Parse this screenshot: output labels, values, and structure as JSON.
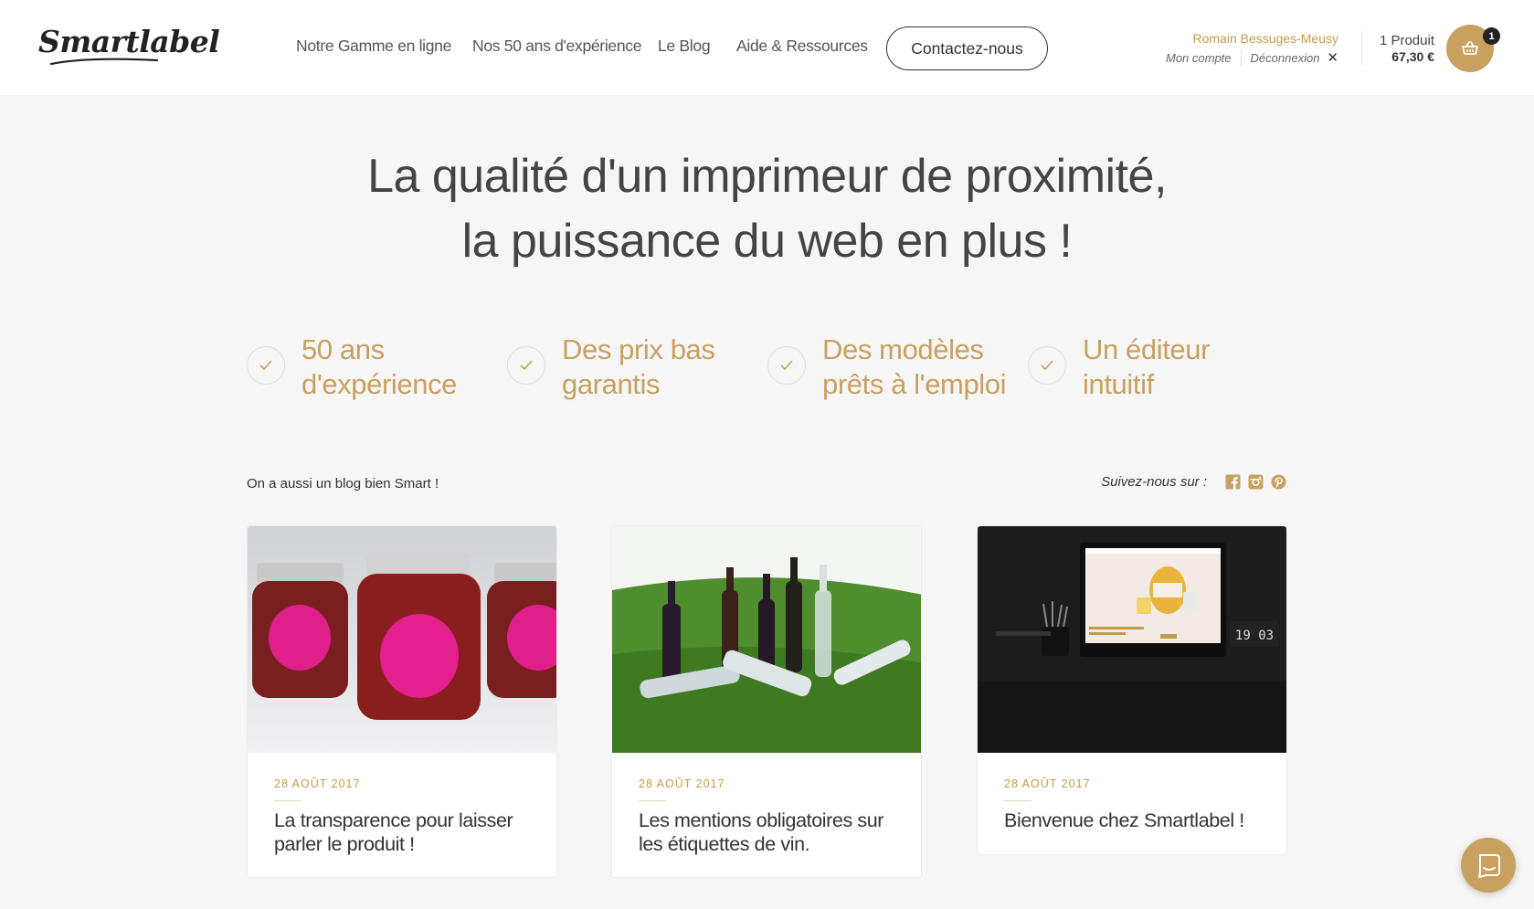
{
  "header": {
    "logo_text": "Smartlabel",
    "nav": [
      {
        "label": "Notre Gamme en ligne"
      },
      {
        "label": "Nos 50 ans d'expérience"
      },
      {
        "label": "Le Blog"
      },
      {
        "label": "Aide & Ressources"
      }
    ],
    "contact_label": "Contactez-nous",
    "user": {
      "name": "Romain Bessuges-Meusy",
      "account_label": "Mon compte",
      "logout_label": "Déconnexion"
    },
    "cart": {
      "count_label": "1 Produit",
      "total": "67,30 €",
      "badge": "1"
    }
  },
  "hero": {
    "line1": "La qualité d'un imprimeur de proximité,",
    "line2": "la puissance du web en plus !"
  },
  "features": [
    {
      "line1": "50 ans",
      "line2": "d'expérience"
    },
    {
      "line1": "Des prix bas",
      "line2": "garantis"
    },
    {
      "line1": "Des modèles",
      "line2": "prêts à l'emploi"
    },
    {
      "line1": "Un éditeur",
      "line2": "intuitif"
    }
  ],
  "blog": {
    "intro": "On a aussi un blog bien Smart !",
    "follow_label": "Suivez-nous sur :",
    "social_icons": [
      "facebook-icon",
      "instagram-icon",
      "pinterest-icon"
    ],
    "posts": [
      {
        "date": "28 AOÛT 2017",
        "title": "La transparence pour laisser parler le produit !",
        "image": "jam-jars"
      },
      {
        "date": "28 AOÛT 2017",
        "title": "Les mentions obligatoires sur les étiquettes de vin.",
        "image": "wine-bottles-on-grass"
      },
      {
        "date": "28 AOÛT 2017",
        "title": "Bienvenue chez Smartlabel !",
        "image": "desk-monitor"
      }
    ]
  },
  "colors": {
    "accent": "#c8a060",
    "background": "#f6f6f6",
    "text": "#333333"
  }
}
